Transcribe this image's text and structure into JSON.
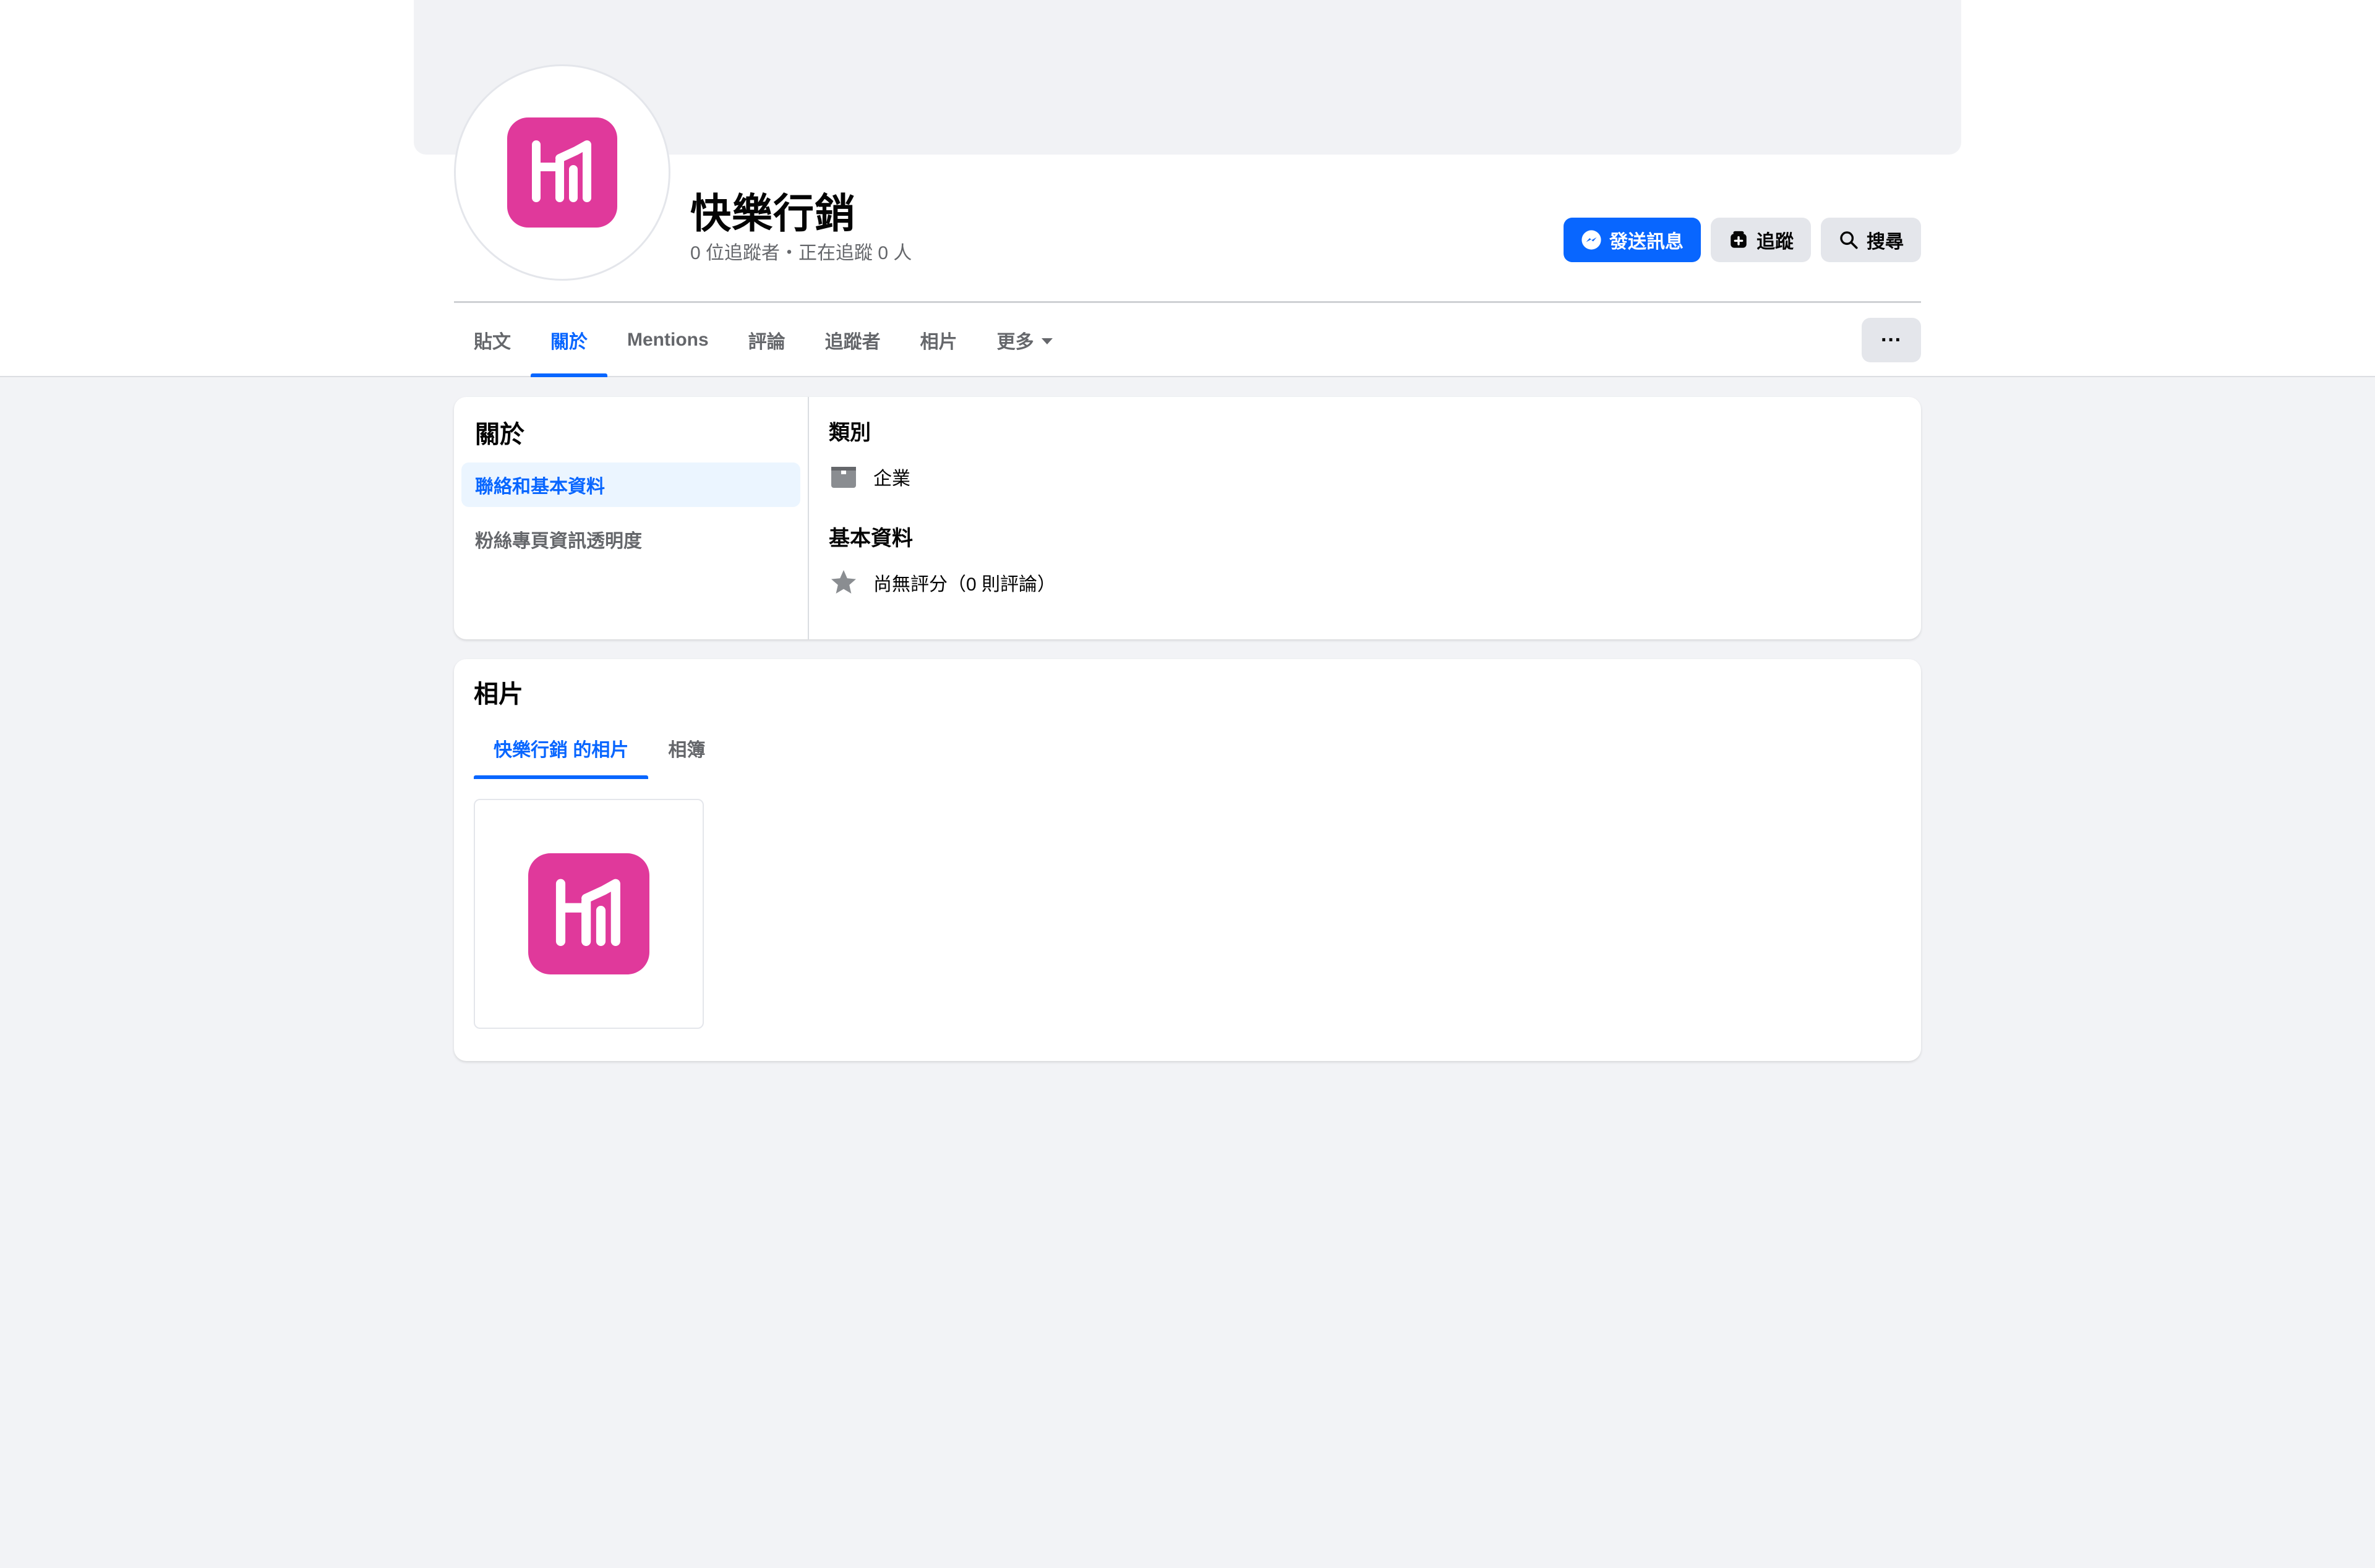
{
  "page": {
    "name": "快樂行銷",
    "stats": "0 位追蹤者・正在追蹤 0 人"
  },
  "actions": {
    "message": "發送訊息",
    "follow": "追蹤",
    "search": "搜尋",
    "more": "···"
  },
  "tabs": [
    "貼文",
    "關於",
    "Mentions",
    "評論",
    "追蹤者",
    "相片",
    "更多"
  ],
  "active_tab": "關於",
  "about": {
    "title": "關於",
    "nav": [
      "聯絡和基本資料",
      "粉絲專頁資訊透明度"
    ],
    "category_heading": "類別",
    "category_value": "企業",
    "basic_heading": "基本資料",
    "rating_text": "尚無評分（0 則評論）"
  },
  "photos": {
    "title": "相片",
    "tabs": [
      "快樂行銷 的相片",
      "相簿"
    ]
  },
  "colors": {
    "brand_logo": "#e0399b",
    "accent": "#0866ff",
    "background": "#f2f3f6"
  },
  "icons": {
    "message": "messenger-icon",
    "follow": "follow-icon",
    "search": "search-icon",
    "category": "briefcase-icon",
    "rating": "star-icon"
  }
}
